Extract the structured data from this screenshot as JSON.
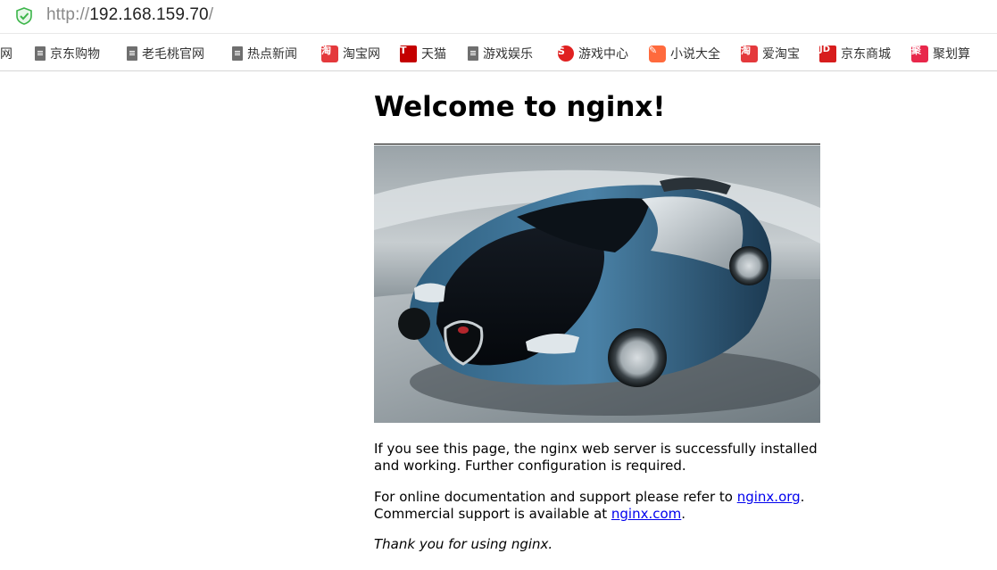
{
  "address_bar": {
    "url_scheme": "http://",
    "url_host": "192.168.159.70",
    "url_path": "/"
  },
  "bookmarks": [
    {
      "label": "网",
      "icon": "none"
    },
    {
      "label": "京东购物",
      "icon": "page-icon"
    },
    {
      "label": "老毛桃官网",
      "icon": "page-icon"
    },
    {
      "label": "热点新闻",
      "icon": "page-icon"
    },
    {
      "label": "淘宝网",
      "icon": "taobao-icon",
      "glyph": "淘"
    },
    {
      "label": "天猫",
      "icon": "tmall-icon",
      "glyph": "T"
    },
    {
      "label": "游戏娱乐",
      "icon": "page-icon"
    },
    {
      "label": "游戏中心",
      "icon": "game-center-icon",
      "glyph": "S"
    },
    {
      "label": "小说大全",
      "icon": "novel-icon",
      "glyph": "✎"
    },
    {
      "label": "爱淘宝",
      "icon": "aitaobao-icon",
      "glyph": "淘"
    },
    {
      "label": "京东商城",
      "icon": "jd-icon",
      "glyph": "JD"
    },
    {
      "label": "聚划算",
      "icon": "juhuasuan-icon",
      "glyph": "聚"
    }
  ],
  "page": {
    "title": "Welcome to nginx!",
    "image_subject": "blue-and-black-sports-car",
    "para1": "If you see this page, the nginx web server is successfully installed and working. Further configuration is required.",
    "para2_prefix": "For online documentation and support please refer to ",
    "link1": "nginx.org",
    "para2_mid": ".",
    "para2_line2": "Commercial support is available at ",
    "link2": "nginx.com",
    "para2_end": ".",
    "para3": "Thank you for using nginx."
  },
  "colors": {
    "link": "#0000ee",
    "shield": "#3cb54a",
    "taobao": "#e4393c",
    "tmall": "#c40000",
    "jd": "#d71d1d"
  }
}
